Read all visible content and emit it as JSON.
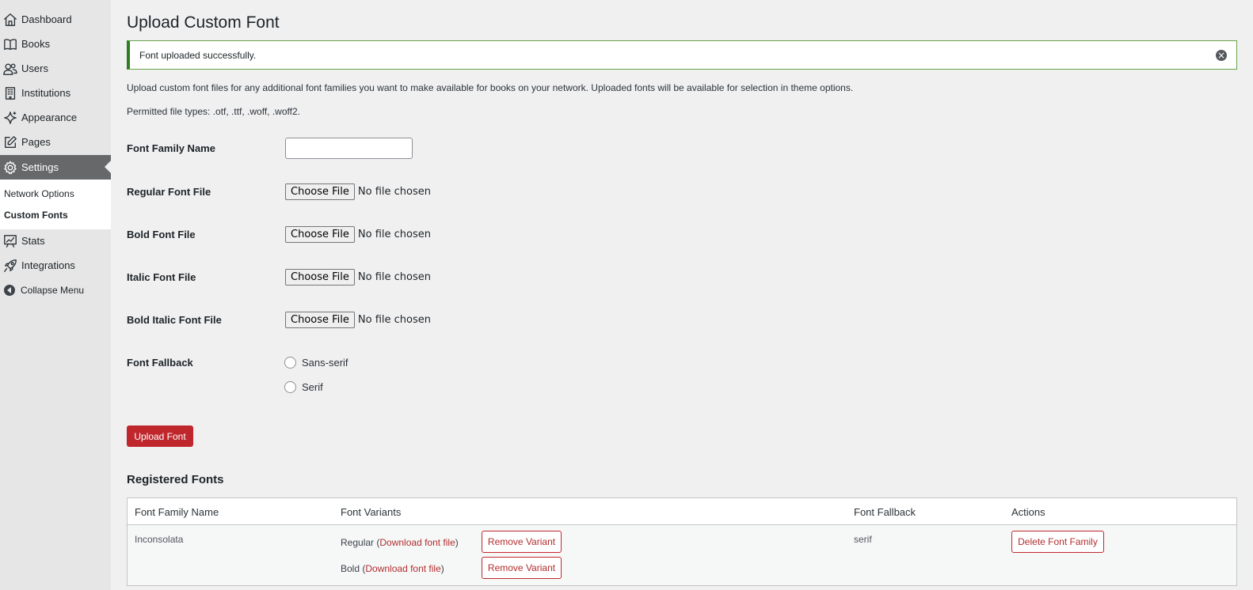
{
  "sidebar": {
    "items": [
      {
        "label": "Dashboard",
        "icon": "home-icon"
      },
      {
        "label": "Books",
        "icon": "book-icon"
      },
      {
        "label": "Users",
        "icon": "users-icon"
      },
      {
        "label": "Institutions",
        "icon": "building-icon"
      },
      {
        "label": "Appearance",
        "icon": "sparkle-icon"
      },
      {
        "label": "Pages",
        "icon": "edit-icon"
      },
      {
        "label": "Settings",
        "icon": "gear-icon",
        "active": true
      },
      {
        "label": "Stats",
        "icon": "chart-icon"
      },
      {
        "label": "Integrations",
        "icon": "rocket-icon"
      },
      {
        "label": "Collapse Menu",
        "icon": "collapse-icon"
      }
    ],
    "submenu": [
      {
        "label": "Network Options"
      },
      {
        "label": "Custom Fonts",
        "current": true
      }
    ]
  },
  "page": {
    "title": "Upload Custom Font",
    "notice": "Font uploaded successfully.",
    "description": "Upload custom font files for any additional font families you want to make available for books on your network. Uploaded fonts will be available for selection in theme options.",
    "permitted": "Permitted file types: .otf, .ttf, .woff, .woff2."
  },
  "form": {
    "family_label": "Font Family Name",
    "family_value": "",
    "choose_file": "Choose File",
    "no_file": "No file chosen",
    "file_fields": [
      {
        "label": "Regular Font File"
      },
      {
        "label": "Bold Font File"
      },
      {
        "label": "Italic Font File"
      },
      {
        "label": "Bold Italic Font File"
      }
    ],
    "fallback_label": "Font Fallback",
    "fallback_options": [
      "Sans-serif",
      "Serif"
    ],
    "upload_button": "Upload Font"
  },
  "registered": {
    "title": "Registered Fonts",
    "columns": [
      "Font Family Name",
      "Font Variants",
      "Font Fallback",
      "Actions"
    ],
    "rows": [
      {
        "family": "Inconsolata",
        "variants": [
          {
            "name": "Regular",
            "link": "Download font file",
            "remove": "Remove Variant"
          },
          {
            "name": "Bold",
            "link": "Download font file",
            "remove": "Remove Variant"
          }
        ],
        "fallback": "serif",
        "action": "Delete Font Family"
      }
    ]
  },
  "colors": {
    "accent": "#c0272d",
    "active_menu": "#67686a",
    "notice_border": "#2e7d20"
  }
}
